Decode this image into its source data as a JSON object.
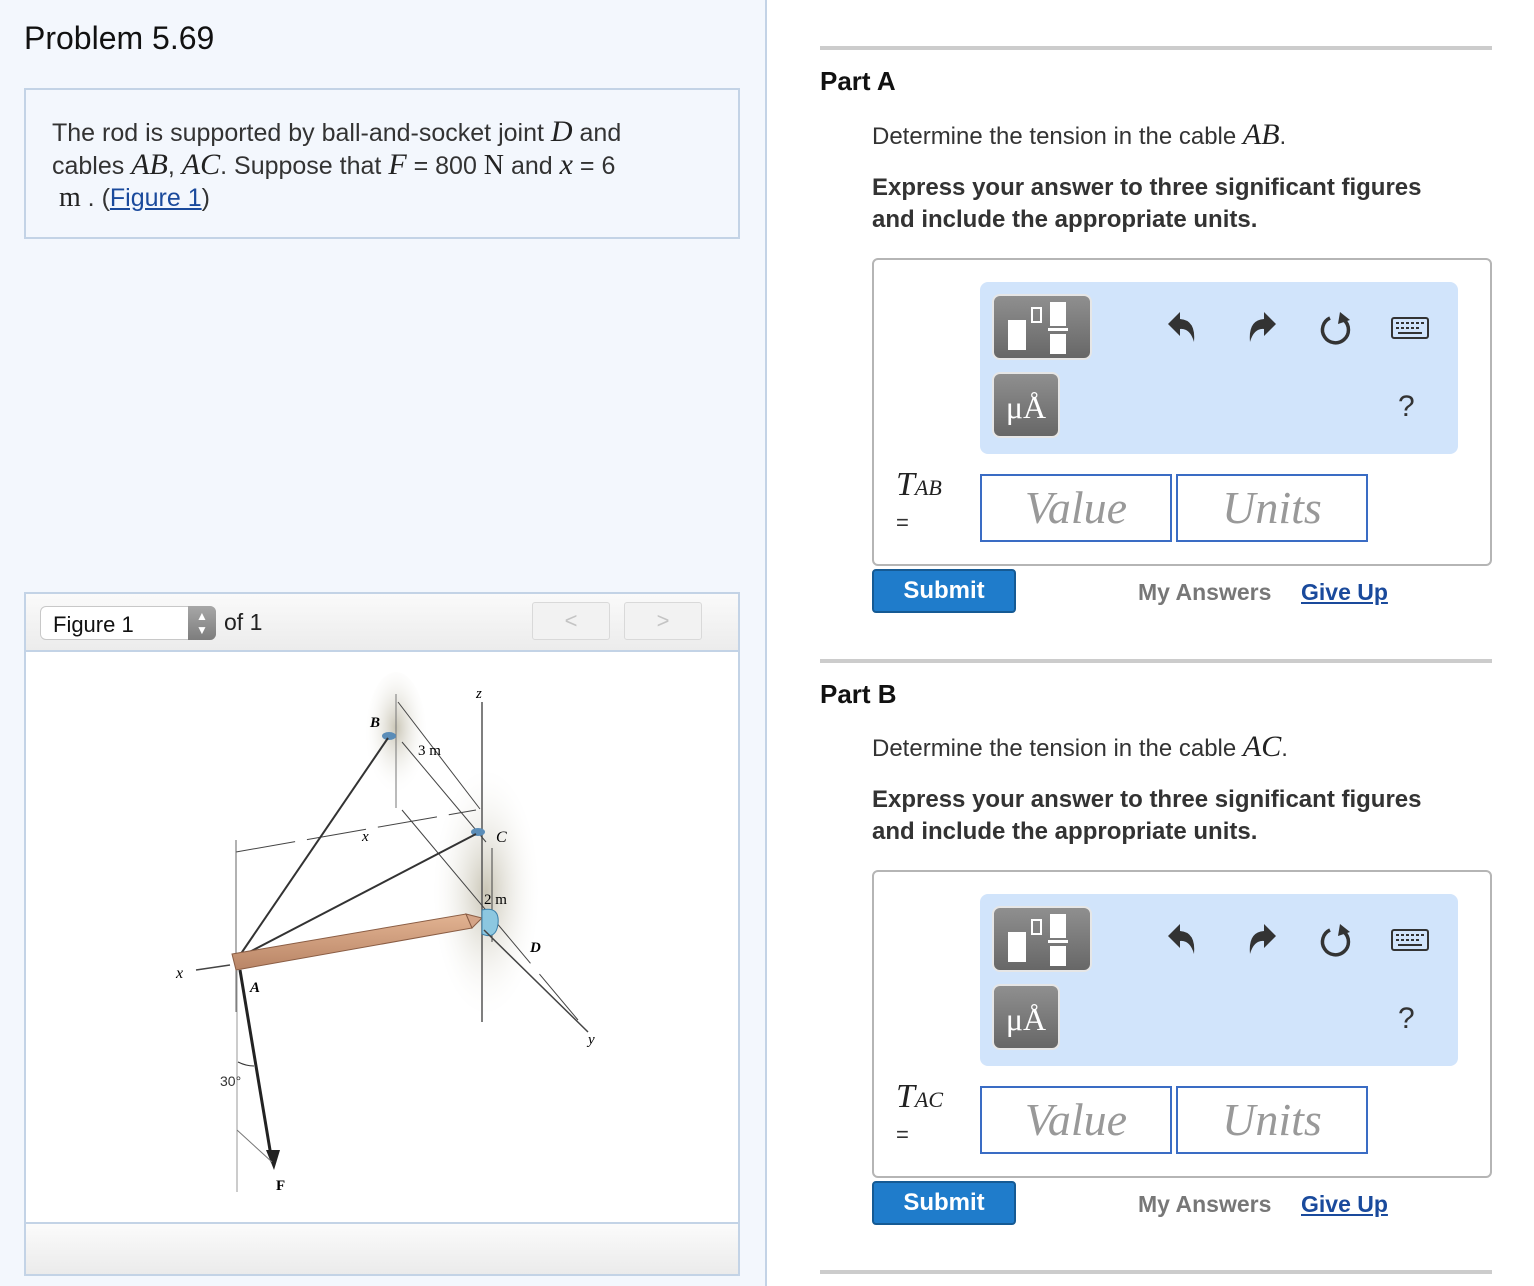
{
  "problem": {
    "title": "Problem 5.69",
    "statement": {
      "line1_text": "The rod is supported by ball-and-socket joint ",
      "line1_math": "D",
      "line1_end": " and",
      "line2_start": "cables ",
      "line2_math1": "AB",
      "line2_comma": ", ",
      "line2_math2": "AC",
      "line2_mid": ". Suppose that ",
      "line2_math3": "F",
      "line2_eq": " = 800 ",
      "line2_unitN": "N",
      "line2_and": " and ",
      "line2_math4": "x",
      "line2_eq2": " = 6",
      "line3_unit": "m",
      "line3_dot": " . (",
      "figure_link": "Figure 1",
      "line3_close": ")"
    }
  },
  "figure_viewer": {
    "selected": "Figure 1",
    "of_label": "of 1",
    "prev_label": "<",
    "next_label": ">",
    "diagram_labels": {
      "z": "z",
      "B": "B",
      "three_m": "3 m",
      "x_dim": "x",
      "C": "C",
      "two_m": "2 m",
      "D": "D",
      "x_axis": "x",
      "A": "A",
      "y": "y",
      "angle": "30°",
      "F": "F"
    }
  },
  "parts": [
    {
      "title": "Part A",
      "question_text": "Determine the tension in the cable ",
      "question_math": "AB",
      "question_end": ".",
      "instruction_line1": "Express your answer to three significant figures",
      "instruction_line2": "and include the appropriate units.",
      "variable": "T",
      "variable_sub": "AB",
      "equals": "=",
      "value_placeholder": "Value",
      "units_placeholder": "Units",
      "submit": "Submit",
      "my_answers": "My Answers",
      "give_up": "Give Up"
    },
    {
      "title": "Part B",
      "question_text": "Determine the tension in the cable ",
      "question_math": "AC",
      "question_end": ".",
      "instruction_line1": "Express your answer to three significant figures",
      "instruction_line2": "and include the appropriate units.",
      "variable": "T",
      "variable_sub": "AC",
      "equals": "=",
      "value_placeholder": "Value",
      "units_placeholder": "Units",
      "submit": "Submit",
      "my_answers": "My Answers",
      "give_up": "Give Up"
    }
  ],
  "toolbar": {
    "units_button_label": "μÅ",
    "help_label": "?",
    "icons": [
      "templates-icon",
      "undo-icon",
      "redo-icon",
      "reset-icon",
      "keyboard-icon",
      "help-icon"
    ]
  },
  "colors": {
    "link": "#1a4a9c",
    "submit_bg": "#1f7ccb",
    "toolbar_bg": "#d1e4fb",
    "input_border": "#3a6cc4",
    "left_pane_bg": "#f3f7fd"
  }
}
